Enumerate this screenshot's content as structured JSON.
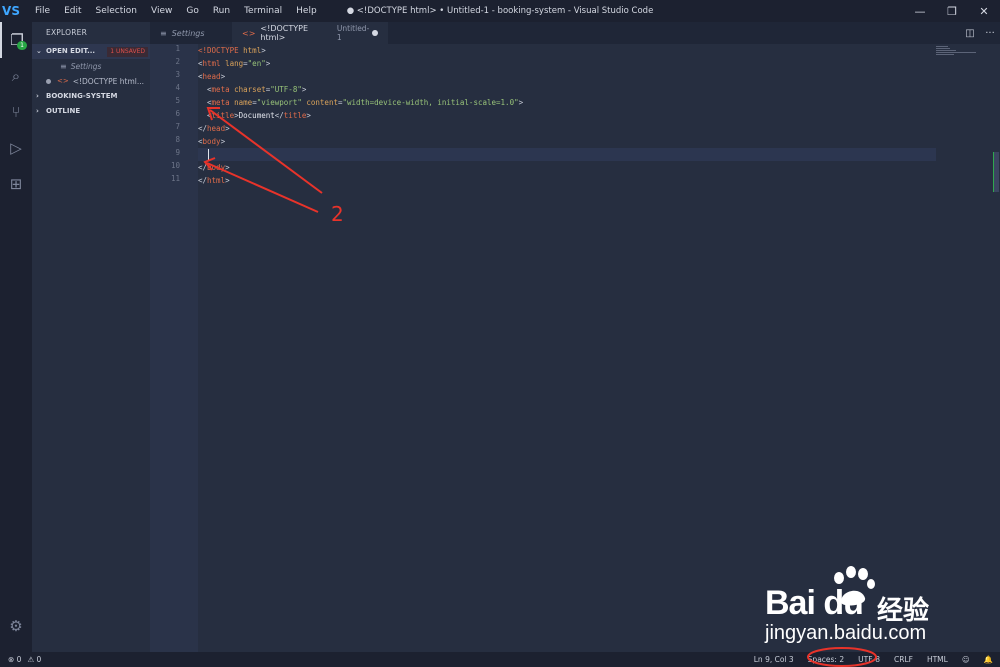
{
  "titlebar": {
    "logo": "VS",
    "menu": [
      "File",
      "Edit",
      "Selection",
      "View",
      "Go",
      "Run",
      "Terminal",
      "Help"
    ],
    "title": "● <!DOCTYPE html> • Untitled-1 - booking-system - Visual Studio Code",
    "controls": [
      "—",
      "❐",
      "✕"
    ]
  },
  "activitybar": {
    "items": [
      {
        "name": "explorer-icon",
        "glyph": "❐",
        "badge": "1"
      },
      {
        "name": "search-icon",
        "glyph": "⌕"
      },
      {
        "name": "source-control-icon",
        "glyph": "⑂"
      },
      {
        "name": "run-debug-icon",
        "glyph": "▷"
      },
      {
        "name": "extensions-icon",
        "glyph": "⊞"
      }
    ],
    "manage_glyph": "⚙"
  },
  "sidebar": {
    "title": "EXPLORER",
    "open_editors": {
      "label": "OPEN EDIT...",
      "unsaved": "1 UNSAVED"
    },
    "files": [
      {
        "label": "Settings"
      },
      {
        "label": "<!DOCTYPE html..."
      }
    ],
    "sections": [
      "BOOKING-SYSTEM",
      "OUTLINE"
    ]
  },
  "tabs": [
    {
      "label": "Settings"
    },
    {
      "label": "<!DOCTYPE html>",
      "desc": "Untitled-1"
    }
  ],
  "editor": {
    "line_numbers": [
      "1",
      "2",
      "3",
      "4",
      "5",
      "6",
      "7",
      "8",
      "9",
      "10",
      "11"
    ],
    "tokens": {
      "l1": [
        "<!DOCTYPE",
        " html",
        ">"
      ],
      "l2": [
        "<",
        "html",
        " lang",
        "=",
        "\"en\"",
        ">"
      ],
      "l3": [
        "<",
        "head",
        ">"
      ],
      "l4": [
        "  <",
        "meta",
        " charset",
        "=",
        "\"UTF-8\"",
        ">"
      ],
      "l5": [
        "  <",
        "meta",
        " name",
        "=",
        "\"viewport\"",
        " content",
        "=",
        "\"width=device-width, initial-scale=1.0\"",
        ">"
      ],
      "l6": [
        "  <",
        "title",
        ">",
        "Document",
        "</",
        "title",
        ">"
      ],
      "l7": [
        "</",
        "head",
        ">"
      ],
      "l8": [
        "<",
        "body",
        ">"
      ],
      "l10": [
        "</",
        "body",
        ">"
      ],
      "l11": [
        "</",
        "html",
        ">"
      ]
    }
  },
  "statusbar": {
    "errors": "⊗ 0",
    "warnings": "⚠ 0",
    "position": "Ln 9, Col 3",
    "spaces": "Spaces: 2",
    "encoding": "UTF-8",
    "eol": "CRLF",
    "language": "HTML",
    "feedback_glyph": "☺",
    "bell_glyph": "🔔"
  },
  "annotation": {
    "label": "2",
    "color": "#e8332a"
  },
  "watermark": {
    "brand": "Bai du",
    "product": "经验",
    "url": "jingyan.baidu.com"
  }
}
